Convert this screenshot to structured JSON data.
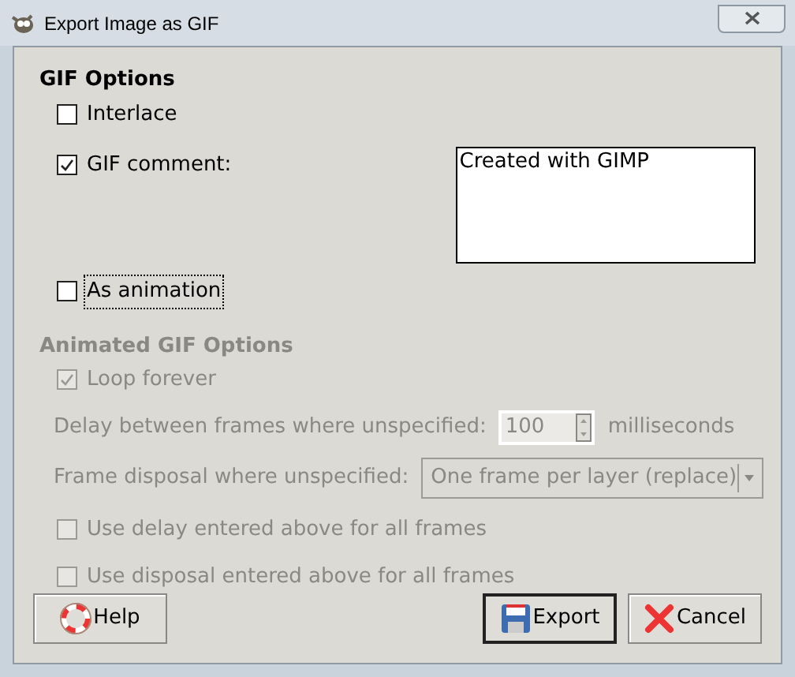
{
  "window": {
    "title": "Export Image as GIF"
  },
  "gif_options": {
    "heading": "GIF Options",
    "interlace": {
      "label": "Interlace",
      "checked": false
    },
    "gif_comment": {
      "label": "GIF comment:",
      "checked": true,
      "value": "Created with GIMP"
    },
    "as_animation": {
      "label": "As animation",
      "checked": false,
      "focused": true
    }
  },
  "animated_options": {
    "heading": "Animated GIF Options",
    "disabled": true,
    "loop_forever": {
      "label": "Loop forever",
      "checked": true
    },
    "delay": {
      "label": "Delay between frames where unspecified:",
      "value": "100",
      "unit": "milliseconds"
    },
    "disposal": {
      "label": "Frame disposal where unspecified:",
      "value": "One frame per layer (replace)"
    },
    "use_delay": {
      "label": "Use delay entered above for all frames",
      "checked": false
    },
    "use_disposal": {
      "label": "Use disposal entered above for all frames",
      "checked": false
    }
  },
  "buttons": [
    {
      "kind": "help",
      "label": "Help",
      "default": false
    },
    {
      "kind": "export",
      "label": "Export",
      "default": true
    },
    {
      "kind": "cancel",
      "label": "Cancel",
      "default": false
    }
  ]
}
